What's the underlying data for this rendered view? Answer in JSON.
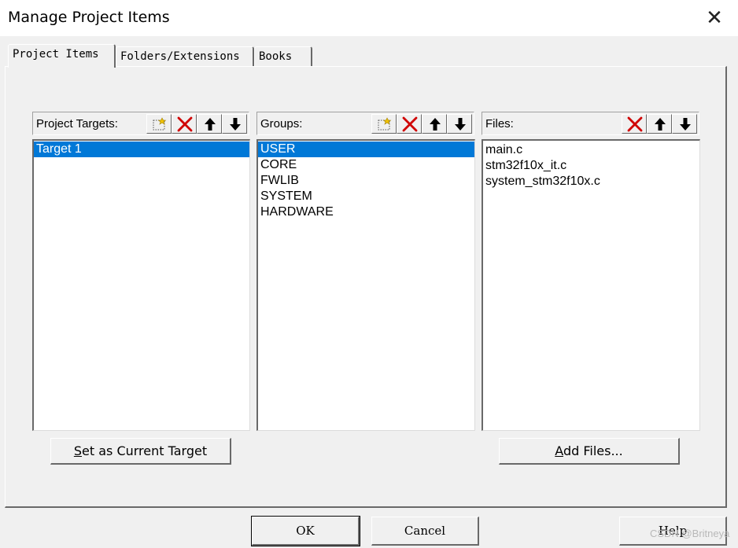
{
  "window": {
    "title": "Manage Project Items",
    "close_glyph": "✕"
  },
  "tabs": [
    {
      "label": "Project Items",
      "active": true
    },
    {
      "label": "Folders/Extensions",
      "active": false
    },
    {
      "label": "Books",
      "active": false
    }
  ],
  "targets_pane": {
    "label": "Project Targets:",
    "items": [
      "Target 1"
    ],
    "selected_index": 0,
    "toolbar": [
      "new-icon",
      "delete-icon",
      "move-up-icon",
      "move-down-icon"
    ]
  },
  "groups_pane": {
    "label": "Groups:",
    "items": [
      "USER",
      "CORE",
      "FWLIB",
      "SYSTEM",
      "HARDWARE"
    ],
    "selected_index": 0,
    "toolbar": [
      "new-icon",
      "delete-icon",
      "move-up-icon",
      "move-down-icon"
    ]
  },
  "files_pane": {
    "label": "Files:",
    "items": [
      "main.c",
      "stm32f10x_it.c",
      "system_stm32f10x.c"
    ],
    "toolbar": [
      "delete-icon",
      "move-up-icon",
      "move-down-icon"
    ]
  },
  "buttons": {
    "set_target": {
      "accel": "S",
      "rest": "et as Current Target"
    },
    "add_files": {
      "accel": "A",
      "rest": "dd Files..."
    },
    "ok": "OK",
    "cancel": "Cancel",
    "help": "Help"
  },
  "watermark": "CSDN @Britneya",
  "colors": {
    "selection": "#0078d7",
    "delete_x": "#d00000"
  }
}
